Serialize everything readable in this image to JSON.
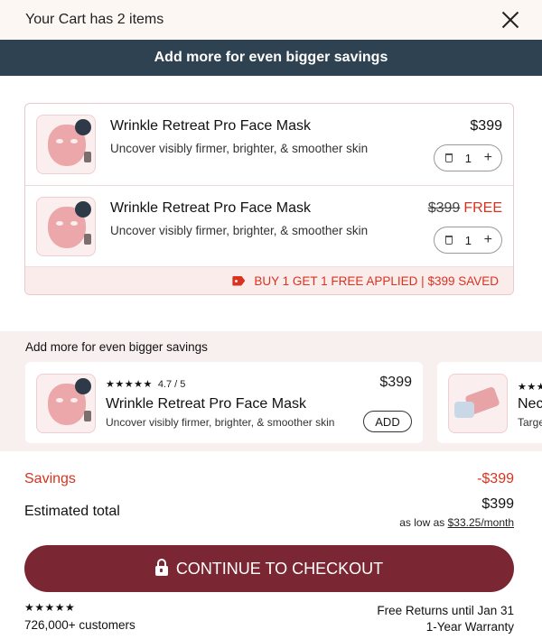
{
  "header": {
    "title": "Your Cart has 2 items"
  },
  "banner": {
    "text": "Add more for even bigger savings"
  },
  "cart_items": [
    {
      "name": "Wrinkle Retreat Pro Face Mask",
      "description": "Uncover visibly firmer, brighter, & smoother skin",
      "price": "$399",
      "quantity": "1"
    },
    {
      "name": "Wrinkle Retreat Pro Face Mask",
      "description": "Uncover visibly firmer, brighter, & smoother skin",
      "original_price": "$399",
      "price": "FREE",
      "quantity": "1"
    }
  ],
  "promo": {
    "text": "BUY 1 GET 1 FREE APPLIED | $399 SAVED"
  },
  "upsell": {
    "heading": "Add more for even bigger savings",
    "cards": [
      {
        "stars": "★★★★★",
        "rating": "4.7 / 5",
        "name": "Wrinkle Retreat Pro Face Mask",
        "description": "Uncover visibly firmer, brighter, & smoother skin",
        "price": "$399",
        "add_label": "ADD"
      },
      {
        "stars": "★★★",
        "name": "Nec",
        "description": "Targe"
      }
    ]
  },
  "summary": {
    "savings_label": "Savings",
    "savings_value": "-$399",
    "total_label": "Estimated total",
    "total_value": "$399",
    "as_low_as": "as low as",
    "monthly": "$33.25/month"
  },
  "checkout": {
    "label": "CONTINUE TO CHECKOUT"
  },
  "footer": {
    "stars": "★★★★★",
    "customers": "726,000+ customers",
    "returns": "Free Returns until Jan 31",
    "warranty": "1-Year Warranty"
  },
  "colors": {
    "banner": "#2f4251",
    "accent_red": "#d8331f",
    "checkout": "#7a2733",
    "header_bg": "#fdf7f4",
    "upsell_bg": "#f8f0ef"
  }
}
